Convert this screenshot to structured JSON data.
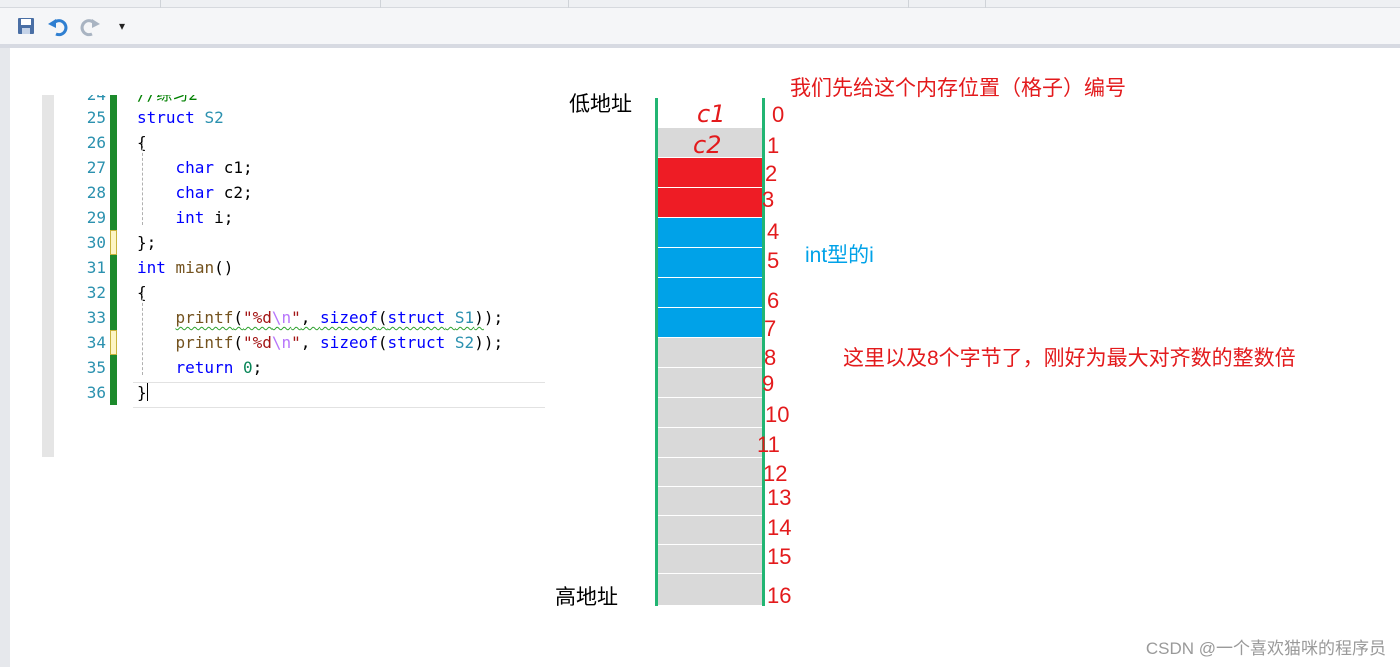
{
  "toolbar": {
    "icons": [
      "save-icon",
      "undo-icon",
      "redo-icon",
      "customize-dropdown-icon"
    ],
    "customize_glyph": "▾"
  },
  "code": {
    "lines": [
      {
        "n": "25",
        "text": "struct S2"
      },
      {
        "n": "26",
        "text": "{"
      },
      {
        "n": "27",
        "text": "char c1;"
      },
      {
        "n": "28",
        "text": "char c2;"
      },
      {
        "n": "29",
        "text": "int i;"
      },
      {
        "n": "30",
        "text": "};"
      },
      {
        "n": "31",
        "text": "int mian()"
      },
      {
        "n": "32",
        "text": "{"
      },
      {
        "n": "33",
        "text": "printf(\"%d\\n\", sizeof(struct S1));"
      },
      {
        "n": "34",
        "text": "printf(\"%d\\n\", sizeof(struct S2));"
      },
      {
        "n": "35",
        "text": "return 0;"
      },
      {
        "n": "36",
        "text": "}"
      }
    ]
  },
  "memory": {
    "low_address_label": "低地址",
    "high_address_label": "高地址",
    "cell_indices": [
      "0",
      "1",
      "2",
      "3",
      "4",
      "5",
      "6",
      "7",
      "8",
      "9",
      "10",
      "11",
      "12",
      "13",
      "14",
      "15",
      "16"
    ],
    "handwritten": {
      "c1": "c1",
      "c2": "c2"
    },
    "colors": {
      "char": "#ee1c25",
      "int": "#00a2e8",
      "padding": "#d9d9d9",
      "border": "#22b573",
      "annotation": "#e31a1c"
    }
  },
  "annotations": {
    "top": "我们先给这个内存位置（格子）编号",
    "int_label": "int型的i",
    "note": "这里以及8个字节了，刚好为最大对齐数的整数倍"
  },
  "watermark": "CSDN @一个喜欢猫咪的程序员"
}
